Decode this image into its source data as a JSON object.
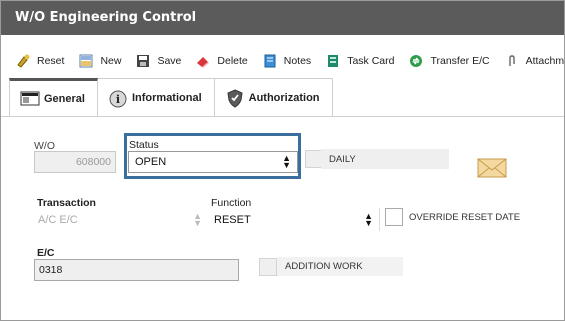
{
  "window": {
    "title": "W/O Engineering Control"
  },
  "toolbar": {
    "buttons": [
      {
        "label": "Reset",
        "icon": "reset-icon"
      },
      {
        "label": "New",
        "icon": "new-icon"
      },
      {
        "label": "Save",
        "icon": "save-icon"
      },
      {
        "label": "Delete",
        "icon": "delete-icon"
      },
      {
        "label": "Notes",
        "icon": "notes-icon"
      },
      {
        "label": "Task Card",
        "icon": "task-card-icon"
      },
      {
        "label": "Transfer E/C",
        "icon": "transfer-icon"
      },
      {
        "label": "Attachme",
        "icon": "attachment-icon"
      }
    ]
  },
  "tabs": [
    {
      "label": "General",
      "active": true
    },
    {
      "label": "Informational",
      "active": false
    },
    {
      "label": "Authorization",
      "active": false
    }
  ],
  "form": {
    "wo": {
      "label": "W/O",
      "value": "608000"
    },
    "status": {
      "label": "Status",
      "value": "OPEN"
    },
    "daily": {
      "label": "DAILY"
    },
    "transaction": {
      "label": "Transaction",
      "value": "A/C E/C"
    },
    "function": {
      "label": "Function",
      "value": "RESET"
    },
    "override_reset_date": {
      "label": "OVERRIDE RESET DATE",
      "checked": false
    },
    "ec": {
      "label": "E/C",
      "value": "0318"
    },
    "addition_work": {
      "label": "ADDITION WORK",
      "checked": false
    }
  }
}
